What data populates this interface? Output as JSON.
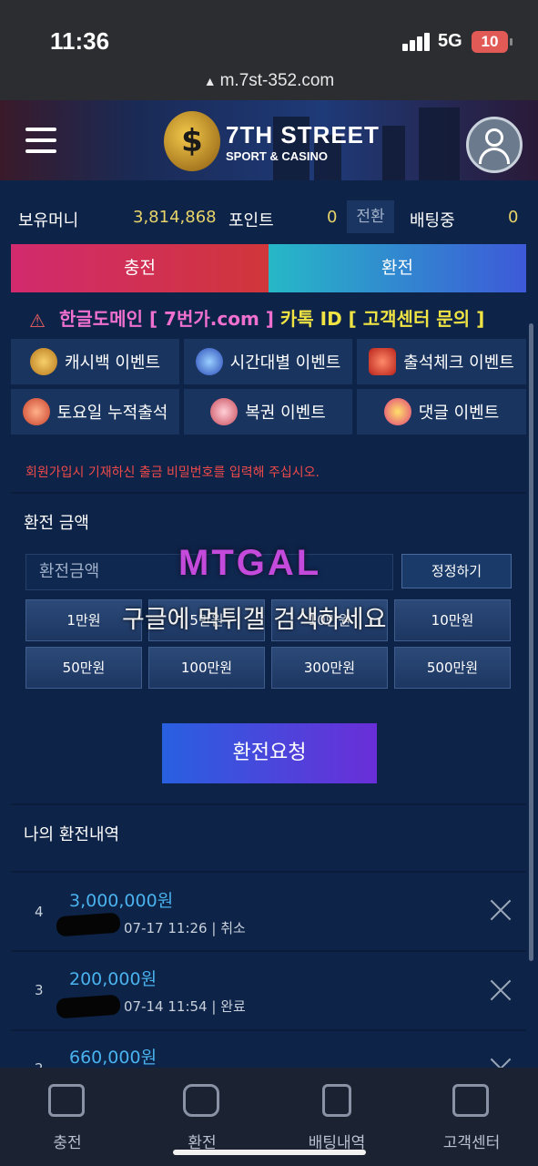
{
  "status_bar": {
    "time": "11:36",
    "network": "5G",
    "battery": "10",
    "url": "m.7st-352.com"
  },
  "brand": {
    "title": "7TH STREET",
    "subtitle": "SPORT & CASINO"
  },
  "money": {
    "holding_label": "보유머니",
    "holding_value": "3,814,868",
    "point_label": "포인트",
    "point_value": "0",
    "convert_label": "전환",
    "betting_label": "배팅중",
    "betting_value": "0"
  },
  "tabs": {
    "charge": "충전",
    "exchange": "환전"
  },
  "notice": {
    "part1": "한글도메인",
    "part2": "[ 7번가.com ]",
    "part3": "카톡 ID [ 고객센터 문의 ]"
  },
  "events": [
    {
      "label": "캐시백 이벤트",
      "color": "#e2a33a"
    },
    {
      "label": "시간대별 이벤트",
      "color": "#4aa0ee"
    },
    {
      "label": "출석체크 이벤트",
      "color": "#e2483a"
    },
    {
      "label": "토요일 누적출석",
      "color": "#e86a3a"
    },
    {
      "label": "복권 이벤트",
      "color": "#e86a8a"
    },
    {
      "label": "댓글 이벤트",
      "color": "#ee5a9a"
    }
  ],
  "form": {
    "warning": "회원가입시 기재하신 출금 비밀번호를 입력해 주십시오.",
    "amount_title": "환전 금액",
    "amount_placeholder": "환전금액",
    "reset_label": "정정하기",
    "amounts": [
      "1만원",
      "5만원",
      "10만원",
      "10만원",
      "50만원",
      "100만원",
      "300만원",
      "500만원"
    ],
    "submit_label": "환전요청"
  },
  "history": {
    "title": "나의 환전내역",
    "rows": [
      {
        "num": "4",
        "amount": "3,000,000원",
        "date": "07-17 11:26",
        "status": "취소"
      },
      {
        "num": "3",
        "amount": "200,000원",
        "date": "07-14 11:54",
        "status": "완료"
      },
      {
        "num": "2",
        "amount": "660,000원",
        "date": "",
        "status": ""
      }
    ]
  },
  "watermark": {
    "logo": "MTGAL",
    "text": "구글에 먹튀갤 검색하세요"
  },
  "bottom_nav": [
    "충전",
    "환전",
    "배팅내역",
    "고객센터"
  ]
}
